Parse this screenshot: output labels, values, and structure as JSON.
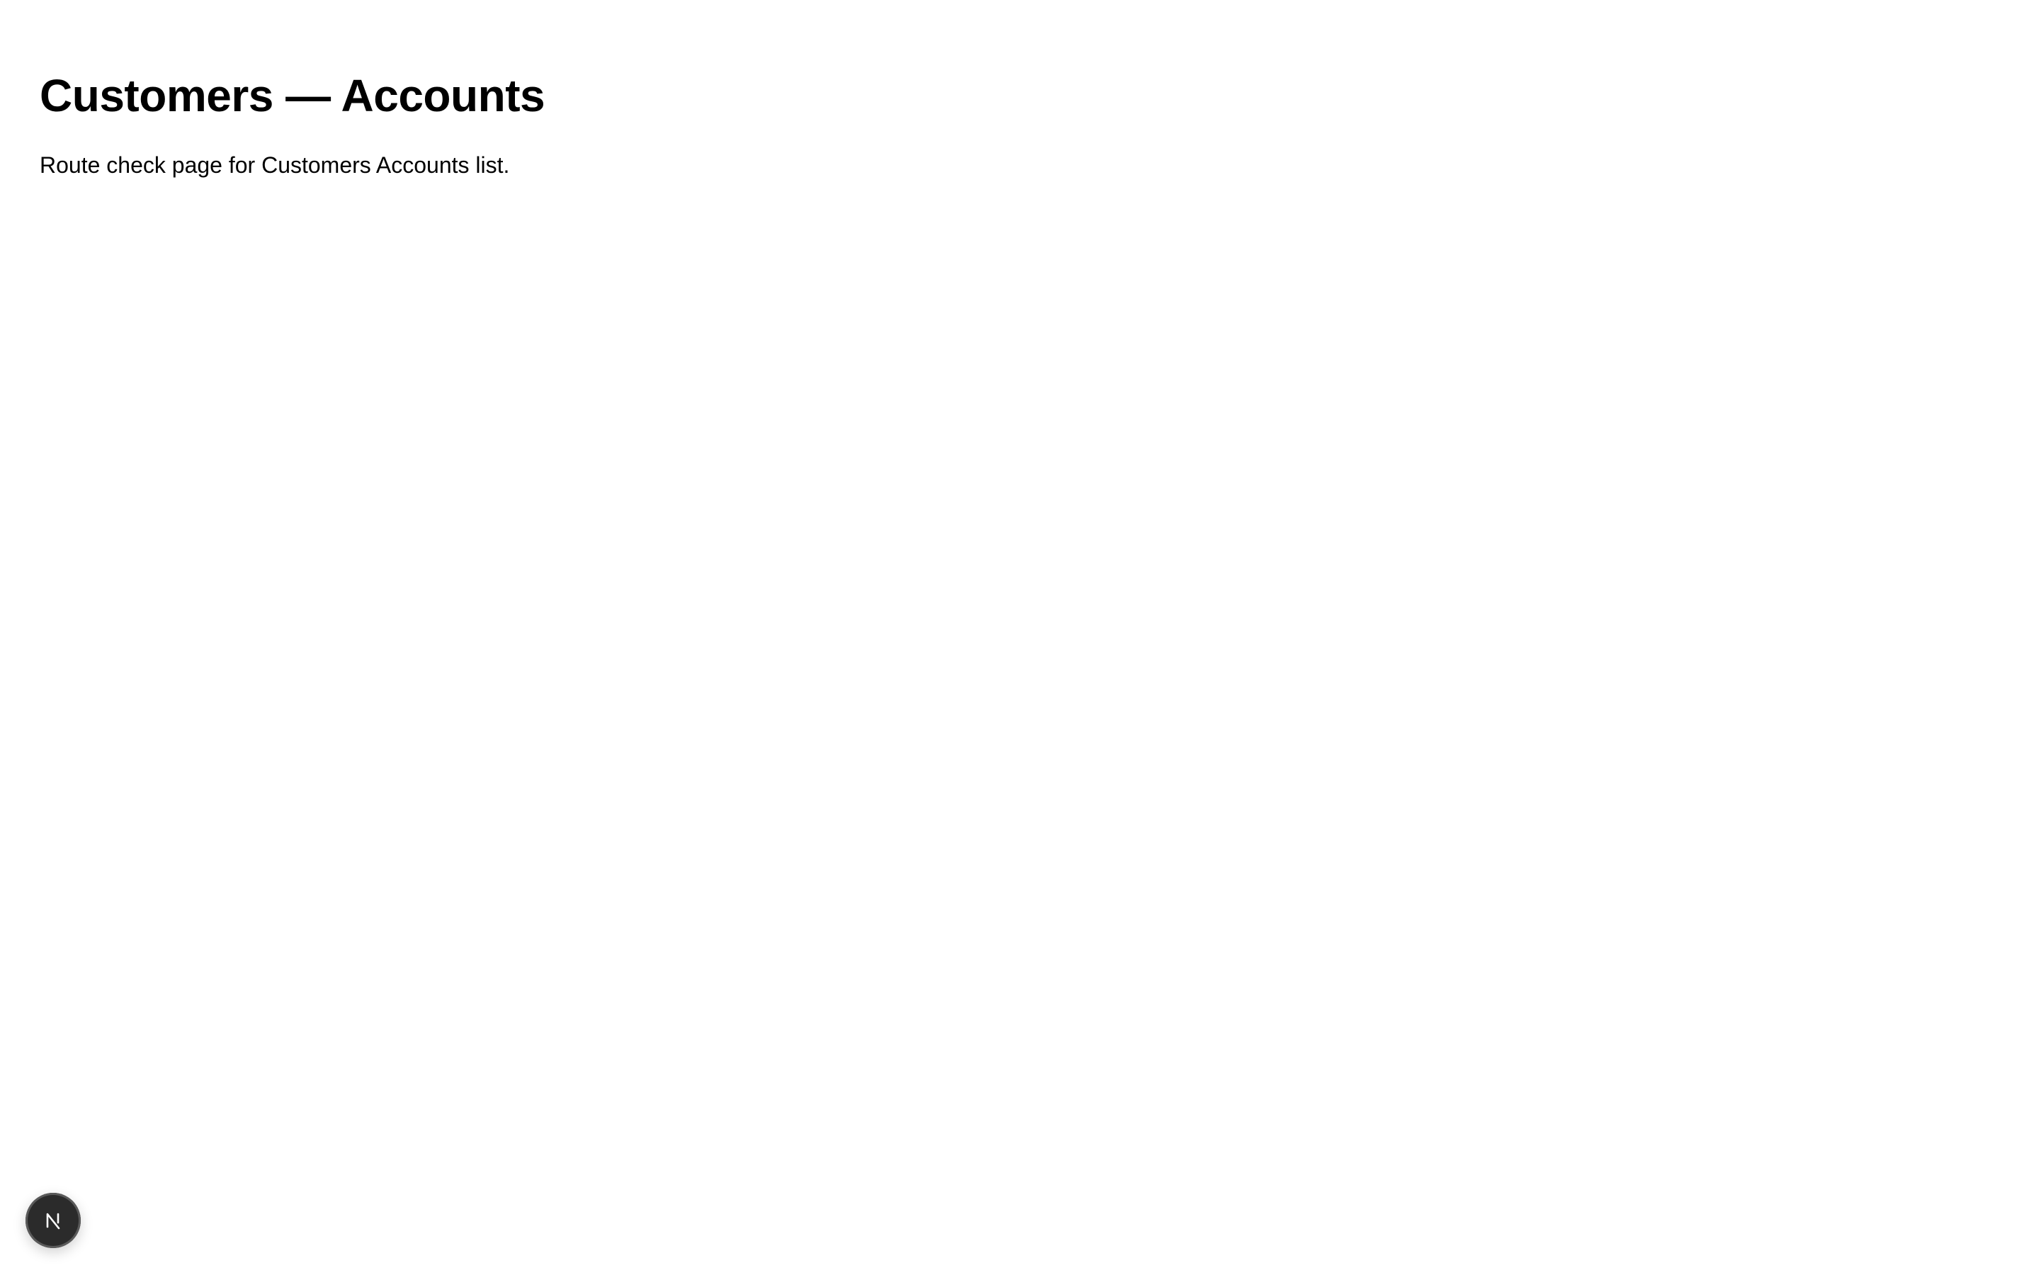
{
  "page": {
    "title": "Customers — Accounts",
    "description": "Route check page for Customers Accounts list."
  },
  "dev_indicator": {
    "icon": "nextjs-logo-icon",
    "background": "#2b2b2b"
  }
}
